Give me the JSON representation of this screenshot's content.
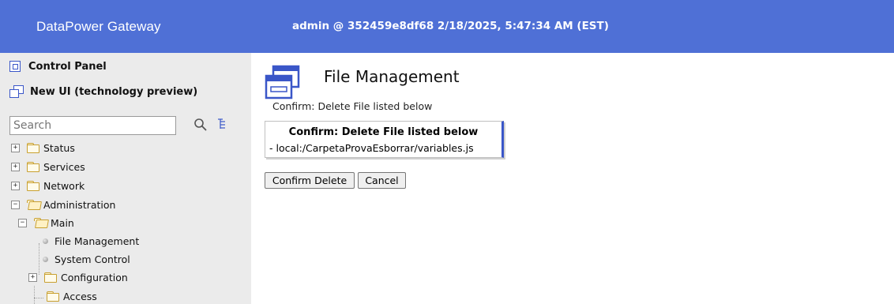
{
  "header": {
    "brand": "DataPower Gateway",
    "session": "admin @ 352459e8df68 2/18/2025, 5:47:34 AM (EST)",
    "background_color": "#4f70d6"
  },
  "sidebar": {
    "control_panel": "Control Panel",
    "new_ui": "New UI (technology preview)",
    "search_placeholder": "Search",
    "tree": [
      {
        "label": "Status",
        "expander": "+"
      },
      {
        "label": "Services",
        "expander": "+"
      },
      {
        "label": "Network",
        "expander": "+"
      },
      {
        "label": "Administration",
        "expander": "−"
      },
      {
        "label": "Main",
        "expander": "−"
      },
      {
        "label": "File Management"
      },
      {
        "label": "System Control"
      },
      {
        "label": "Configuration",
        "expander": "+"
      },
      {
        "label": "Access"
      }
    ]
  },
  "main": {
    "title": "File Management",
    "subtitle": "Confirm: Delete File listed below",
    "confirm_heading": "Confirm: Delete File listed below",
    "file_path": "- local:/CarpetaProvaEsborrar/variables.js",
    "confirm_button": "Confirm Delete",
    "cancel_button": "Cancel",
    "accent_color": "#3a56c8"
  }
}
